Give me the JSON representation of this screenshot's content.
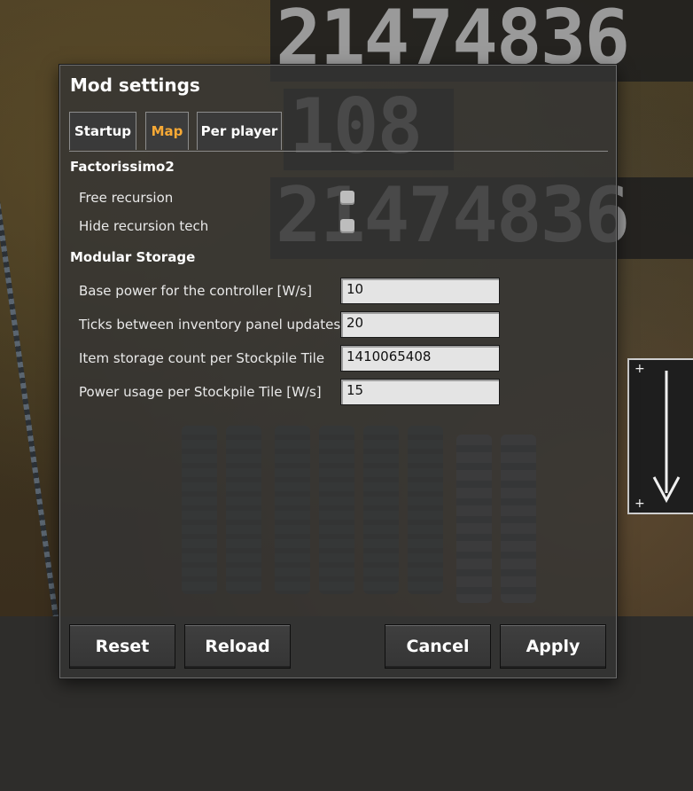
{
  "background": {
    "display_top": "21474836",
    "display_middle": "108",
    "display_bottom": "21474836"
  },
  "dialog": {
    "title": "Mod settings",
    "tabs": [
      {
        "label": "Startup",
        "active": false
      },
      {
        "label": "Map",
        "active": true
      },
      {
        "label": "Per player",
        "active": false
      }
    ],
    "sections": [
      {
        "title": "Factorissimo2",
        "settings": [
          {
            "label": "Free recursion",
            "type": "checkbox",
            "checked": false
          },
          {
            "label": "Hide recursion tech",
            "type": "checkbox",
            "checked": false
          }
        ]
      },
      {
        "title": "Modular Storage",
        "settings": [
          {
            "label": "Base power for the controller [W/s]",
            "type": "text",
            "value": "10"
          },
          {
            "label": "Ticks between inventory panel updates",
            "type": "text",
            "value": "20"
          },
          {
            "label": "Item storage count per Stockpile Tile",
            "type": "text",
            "value": "1410065408"
          },
          {
            "label": "Power usage per Stockpile Tile [W/s]",
            "type": "text",
            "value": "15"
          }
        ]
      }
    ],
    "buttons": {
      "reset": "Reset",
      "reload": "Reload",
      "cancel": "Cancel",
      "apply": "Apply"
    }
  },
  "colors": {
    "active_tab": "#f7a935",
    "dialog_bg": "#343434",
    "text": "#ffffff"
  }
}
